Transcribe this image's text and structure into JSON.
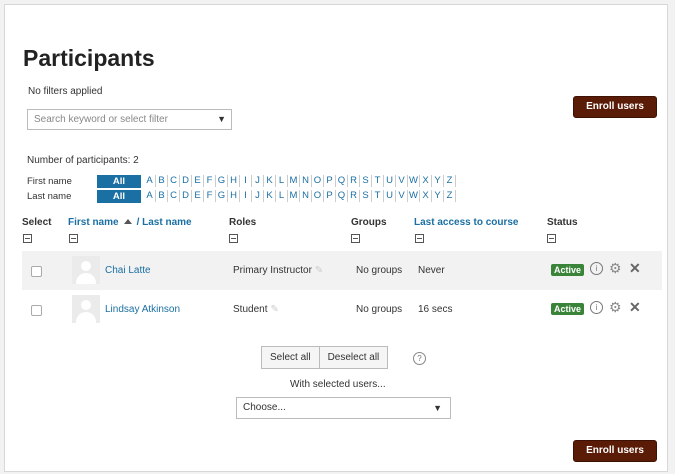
{
  "page_title": "Participants",
  "filters_status": "No filters applied",
  "search": {
    "placeholder": "Search keyword or select filter",
    "caret": "▼"
  },
  "enroll_button": "Enroll users",
  "participant_count": "Number of participants: 2",
  "initials": {
    "first_label": "First name",
    "last_label": "Last name",
    "all": "All",
    "letters": [
      "A",
      "B",
      "C",
      "D",
      "E",
      "F",
      "G",
      "H",
      "I",
      "J",
      "K",
      "L",
      "M",
      "N",
      "O",
      "P",
      "Q",
      "R",
      "S",
      "T",
      "U",
      "V",
      "W",
      "X",
      "Y",
      "Z"
    ]
  },
  "table": {
    "headers": {
      "select": "Select",
      "first_name": "First name",
      "last_name": "/ Last name",
      "roles": "Roles",
      "groups": "Groups",
      "last_access": "Last access to course",
      "status": "Status"
    },
    "rows": [
      {
        "name": "Chai Latte",
        "role": "Primary Instructor",
        "groups": "No groups",
        "last_access": "Never",
        "status": "Active"
      },
      {
        "name": "Lindsay Atkinson",
        "role": "Student",
        "groups": "No groups",
        "last_access": "16 secs",
        "status": "Active"
      }
    ]
  },
  "actions": {
    "select_all": "Select all",
    "deselect_all": "Deselect all",
    "with_selected": "With selected users...",
    "choose": "Choose...",
    "caret": "▼"
  },
  "colors": {
    "brand_button": "#5a1c06",
    "link": "#1a6fa3",
    "active_badge": "#398439"
  }
}
